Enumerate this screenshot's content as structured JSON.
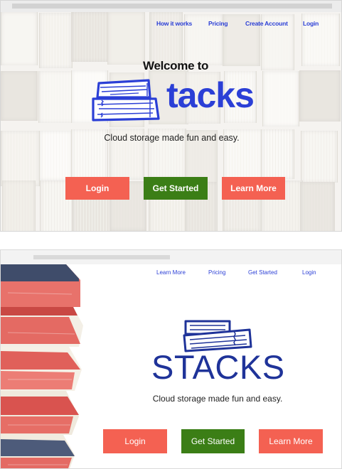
{
  "mockup1": {
    "nav": [
      "How it works",
      "Pricing",
      "Create Account",
      "Login"
    ],
    "welcome": "Welcome to",
    "brand": "tacks",
    "tagline": "Cloud storage made fun and easy.",
    "buttons": {
      "login": "Login",
      "get_started": "Get Started",
      "learn_more": "Learn More"
    }
  },
  "mockup2": {
    "nav": [
      "Learn More",
      "Pricing",
      "Get Started",
      "Login"
    ],
    "brand": "STACKS",
    "tagline": "Cloud storage made fun and easy.",
    "buttons": {
      "login": "Login",
      "get_started": "Get Started",
      "learn_more": "Learn More"
    }
  },
  "colors": {
    "accent_blue": "#2b3fd6",
    "brand_navy": "#1f3399",
    "button_coral": "#f46152",
    "button_green": "#3b7e16"
  },
  "icons": [
    "stacks-logo-icon",
    "books-background",
    "red-books-stack-image"
  ]
}
